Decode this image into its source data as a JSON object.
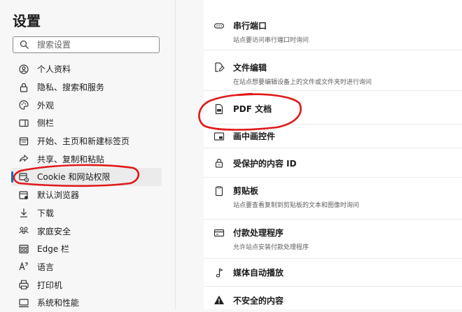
{
  "sidebar": {
    "title": "设置",
    "search": {
      "placeholder": "搜索设置",
      "value": ""
    },
    "items": [
      {
        "label": "个人资料",
        "icon": "profile-icon"
      },
      {
        "label": "隐私、搜索和服务",
        "icon": "lock-icon"
      },
      {
        "label": "外观",
        "icon": "palette-icon"
      },
      {
        "label": "侧栏",
        "icon": "sidebar-icon"
      },
      {
        "label": "开始、主页和新建标签页",
        "icon": "home-tab-icon"
      },
      {
        "label": "共享、复制和粘贴",
        "icon": "share-icon"
      },
      {
        "label": "Cookie 和网站权限",
        "icon": "site-permissions-icon",
        "active": true
      },
      {
        "label": "默认浏览器",
        "icon": "browser-icon"
      },
      {
        "label": "下载",
        "icon": "download-icon"
      },
      {
        "label": "家庭安全",
        "icon": "family-icon"
      },
      {
        "label": "Edge 栏",
        "icon": "edge-bar-icon"
      },
      {
        "label": "语言",
        "icon": "language-icon"
      },
      {
        "label": "打印机",
        "icon": "printer-icon"
      },
      {
        "label": "系统和性能",
        "icon": "system-icon"
      }
    ]
  },
  "permissions": [
    {
      "label": "串行端口",
      "desc": "站点要访问串行端口时询问",
      "icon": "serial-port-icon"
    },
    {
      "label": "文件编辑",
      "desc": "在站点想要编辑设备上的文件或文件夹时进行询问",
      "icon": "file-edit-icon"
    },
    {
      "label": "PDF 文档",
      "desc": "",
      "icon": "pdf-document-icon"
    },
    {
      "label": "画中画控件",
      "desc": "",
      "icon": "picture-in-picture-icon"
    },
    {
      "label": "受保护的内容 ID",
      "desc": "",
      "icon": "protected-content-icon"
    },
    {
      "label": "剪贴板",
      "desc": "站点要查看复制到剪贴板的文本和图像时询问",
      "icon": "clipboard-icon"
    },
    {
      "label": "付款处理程序",
      "desc": "允许站点安装付款处理程序",
      "icon": "payment-icon"
    },
    {
      "label": "媒体自动播放",
      "desc": "",
      "icon": "music-note-icon"
    },
    {
      "label": "不安全的内容",
      "desc": "",
      "icon": "warning-icon"
    }
  ],
  "colors": {
    "accent": "#0f6cbd",
    "annotation": "#e0191b"
  }
}
